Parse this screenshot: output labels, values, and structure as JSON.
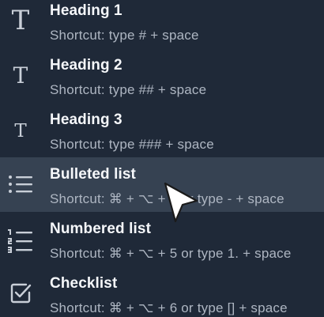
{
  "menu": {
    "items": [
      {
        "title": "Heading 1",
        "shortcut": "Shortcut: type # + space",
        "icon": "heading-1-icon",
        "selected": false
      },
      {
        "title": "Heading 2",
        "shortcut": "Shortcut: type ## + space",
        "icon": "heading-2-icon",
        "selected": false
      },
      {
        "title": "Heading 3",
        "shortcut": "Shortcut: type ### + space",
        "icon": "heading-3-icon",
        "selected": false
      },
      {
        "title": "Bulleted list",
        "shortcut": "Shortcut: ⌘ + ⌥ + 8 or type - + space",
        "icon": "bulleted-list-icon",
        "selected": true
      },
      {
        "title": "Numbered list",
        "shortcut": "Shortcut: ⌘ + ⌥ + 5 or type 1. + space",
        "icon": "numbered-list-icon",
        "selected": false
      },
      {
        "title": "Checklist",
        "shortcut": "Shortcut: ⌘ + ⌥ + 6 or type [] + space",
        "icon": "checklist-icon",
        "selected": false
      }
    ]
  },
  "colors": {
    "background": "#1f2938",
    "selected_background": "#364252",
    "title_text": "#f5f7fa",
    "subtitle_text": "#aeb6c2",
    "icon": "#c9cfd8"
  }
}
